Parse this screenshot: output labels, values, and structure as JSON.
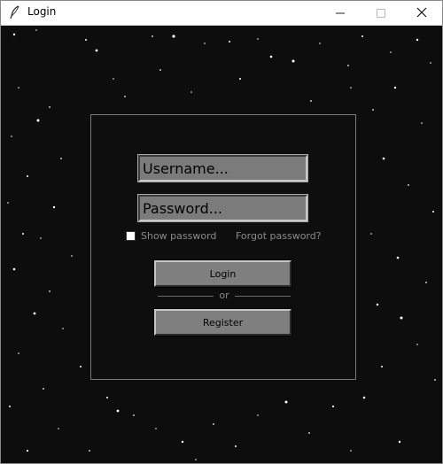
{
  "window": {
    "title": "Login",
    "controls": [
      "minimize",
      "maximize",
      "close"
    ]
  },
  "form": {
    "username": {
      "placeholder": "Username..."
    },
    "password": {
      "placeholder": "Password..."
    },
    "show_password_label": "Show password",
    "forgot_password_label": "Forgot password?",
    "login_label": "Login",
    "separator_label": "or",
    "register_label": "Register"
  },
  "colors": {
    "background": "#0d0d0d",
    "panel_border": "#7a7a7a",
    "field_bg": "#7b7b7b",
    "button_bg": "#7f7f7f",
    "muted_text": "#8a8a8a"
  },
  "icons": {
    "app": "feather-icon",
    "minimize": "minimize-icon",
    "maximize": "maximize-icon",
    "close": "close-icon"
  }
}
